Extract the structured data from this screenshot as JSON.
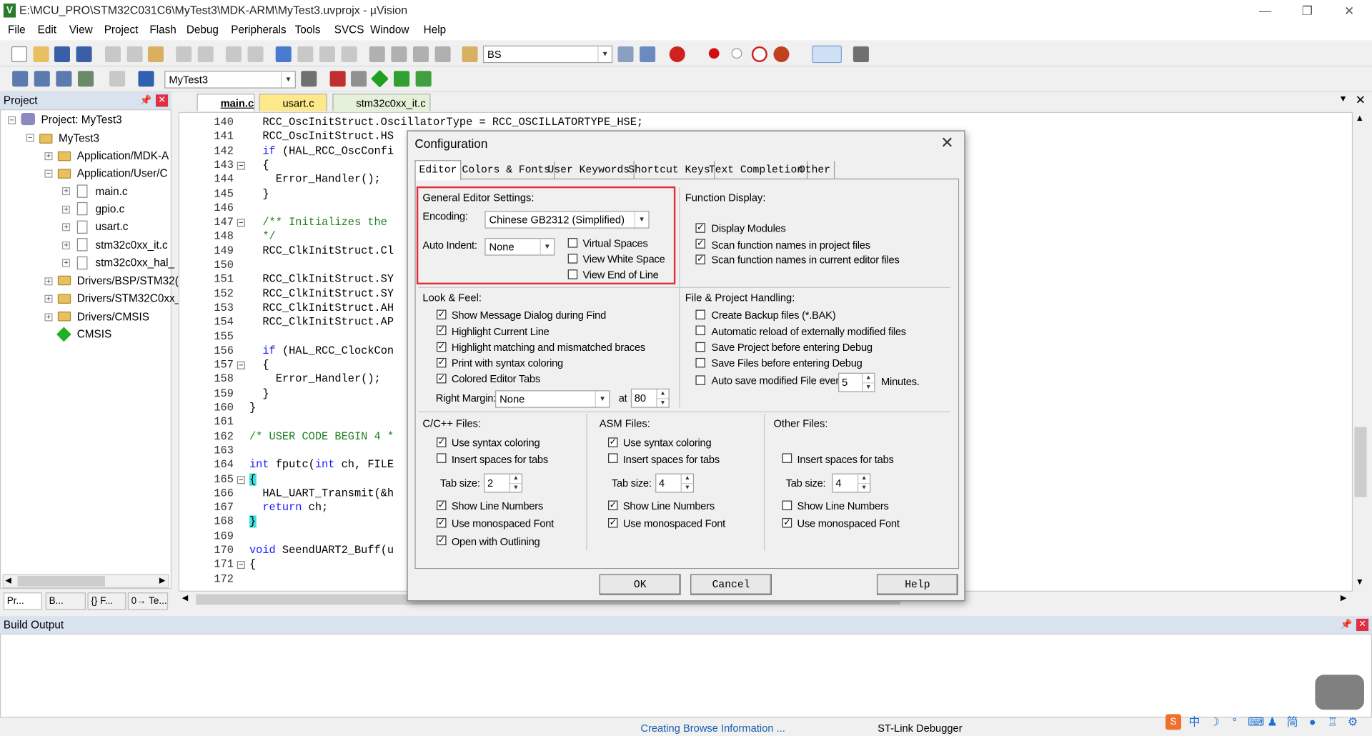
{
  "window": {
    "title": "E:\\MCU_PRO\\STM32C031C6\\MyTest3\\MDK-ARM\\MyTest3.uvprojx - µVision",
    "minimize": "—",
    "restore": "❐",
    "close": "✕"
  },
  "menu": [
    "File",
    "Edit",
    "View",
    "Project",
    "Flash",
    "Debug",
    "Peripherals",
    "Tools",
    "SVCS",
    "Window",
    "Help"
  ],
  "toolbar": {
    "find_text": "BS",
    "target": "MyTest3"
  },
  "project": {
    "header": "Project",
    "root": "Project: MyTest3",
    "target": "MyTest3",
    "groups": [
      "Application/MDK-A",
      "Application/User/C",
      "main.c",
      "gpio.c",
      "usart.c",
      "stm32c0xx_it.c",
      "stm32c0xx_hal_",
      "Drivers/BSP/STM32(",
      "Drivers/STM32C0xx_",
      "Drivers/CMSIS",
      "CMSIS"
    ],
    "tabs": [
      "Pr...",
      "B...",
      "{} F...",
      "0→ Te..."
    ]
  },
  "editor": {
    "tabs": [
      "main.c",
      "usart.c",
      "stm32c0xx_it.c"
    ],
    "lines": [
      {
        "n": "140",
        "t": "  RCC_OscInitStruct.OscillatorType = RCC_OSCILLATORTYPE_HSE;"
      },
      {
        "n": "141",
        "t": "  RCC_OscInitStruct.HS"
      },
      {
        "n": "142",
        "t": "  if (HAL_RCC_OscConfi"
      },
      {
        "n": "143",
        "t": "  {"
      },
      {
        "n": "144",
        "t": "    Error_Handler();"
      },
      {
        "n": "145",
        "t": "  }"
      },
      {
        "n": "146",
        "t": ""
      },
      {
        "n": "147",
        "t": "  /** Initializes the"
      },
      {
        "n": "148",
        "t": "  */"
      },
      {
        "n": "149",
        "t": "  RCC_ClkInitStruct.Cl"
      },
      {
        "n": "150",
        "t": ""
      },
      {
        "n": "151",
        "t": "  RCC_ClkInitStruct.SY"
      },
      {
        "n": "152",
        "t": "  RCC_ClkInitStruct.SY"
      },
      {
        "n": "153",
        "t": "  RCC_ClkInitStruct.AH"
      },
      {
        "n": "154",
        "t": "  RCC_ClkInitStruct.AP"
      },
      {
        "n": "155",
        "t": ""
      },
      {
        "n": "156",
        "t": "  if (HAL_RCC_ClockCon"
      },
      {
        "n": "157",
        "t": "  {"
      },
      {
        "n": "158",
        "t": "    Error_Handler();"
      },
      {
        "n": "159",
        "t": "  }"
      },
      {
        "n": "160",
        "t": "}"
      },
      {
        "n": "161",
        "t": ""
      },
      {
        "n": "162",
        "t": "/* USER CODE BEGIN 4 *"
      },
      {
        "n": "163",
        "t": ""
      },
      {
        "n": "164",
        "t": "int fputc(int ch, FILE"
      },
      {
        "n": "165",
        "t": "{"
      },
      {
        "n": "166",
        "t": "  HAL_UART_Transmit(&h"
      },
      {
        "n": "167",
        "t": "  return ch;"
      },
      {
        "n": "168",
        "t": "}"
      },
      {
        "n": "169",
        "t": ""
      },
      {
        "n": "170",
        "t": "void SeendUART2_Buff(u"
      },
      {
        "n": "171",
        "t": "{"
      },
      {
        "n": "172",
        "t": ""
      }
    ]
  },
  "build": {
    "header": "Build Output"
  },
  "status": {
    "left": "Creating Browse Information ...",
    "right": "ST-Link Debugger"
  },
  "dialog": {
    "title": "Configuration",
    "tabs": [
      "Editor",
      "Colors & Fonts",
      "User Keywords",
      "Shortcut Keys",
      "Text Completion",
      "Other"
    ],
    "general": {
      "title": "General Editor Settings:",
      "encoding_label": "Encoding:",
      "encoding_value": "Chinese GB2312 (Simplified)",
      "auto_indent_label": "Auto Indent:",
      "auto_indent_value": "None",
      "virtual_spaces": "Virtual Spaces",
      "view_white_space": "View White Space",
      "view_end_of_line": "View End of Line"
    },
    "function_display": {
      "title": "Function Display:",
      "display_modules": "Display Modules",
      "scan_project": "Scan function names in project files",
      "scan_editor": "Scan function names in current editor files"
    },
    "look": {
      "title": "Look & Feel:",
      "items": [
        "Show Message Dialog during Find",
        "Highlight Current Line",
        "Highlight matching and mismatched braces",
        "Print with syntax coloring",
        "Colored Editor Tabs"
      ],
      "right_margin_label": "Right Margin:",
      "right_margin_value": "None",
      "at_label": "at",
      "at_value": "80"
    },
    "file_project": {
      "title": "File & Project Handling:",
      "items": [
        "Create Backup files (*.BAK)",
        "Automatic reload of externally modified files",
        "Save Project before entering Debug",
        "Save Files before entering Debug"
      ],
      "auto_save": "Auto save modified File every",
      "auto_save_value": "5",
      "minutes": "Minutes."
    },
    "cpp": {
      "title": "C/C++ Files:",
      "syntax": "Use syntax coloring",
      "insert_spaces": "Insert spaces for tabs",
      "tab_label": "Tab size:",
      "tab_value": "2",
      "line_numbers": "Show Line Numbers",
      "monospaced": "Use monospaced Font",
      "outlining": "Open with Outlining"
    },
    "asm": {
      "title": "ASM Files:",
      "syntax": "Use syntax coloring",
      "insert_spaces": "Insert spaces for tabs",
      "tab_label": "Tab size:",
      "tab_value": "4",
      "line_numbers": "Show Line Numbers",
      "monospaced": "Use monospaced Font"
    },
    "other": {
      "title": "Other Files:",
      "insert_spaces": "Insert spaces for tabs",
      "tab_label": "Tab size:",
      "tab_value": "4",
      "line_numbers": "Show Line Numbers",
      "monospaced": "Use monospaced Font"
    },
    "buttons": {
      "ok": "OK",
      "cancel": "Cancel",
      "help": "Help"
    }
  },
  "colors": {
    "accent_red": "#e03040",
    "header_blue": "#d9e3f0",
    "keyword": "#1a1aff",
    "comment": "#208020"
  }
}
